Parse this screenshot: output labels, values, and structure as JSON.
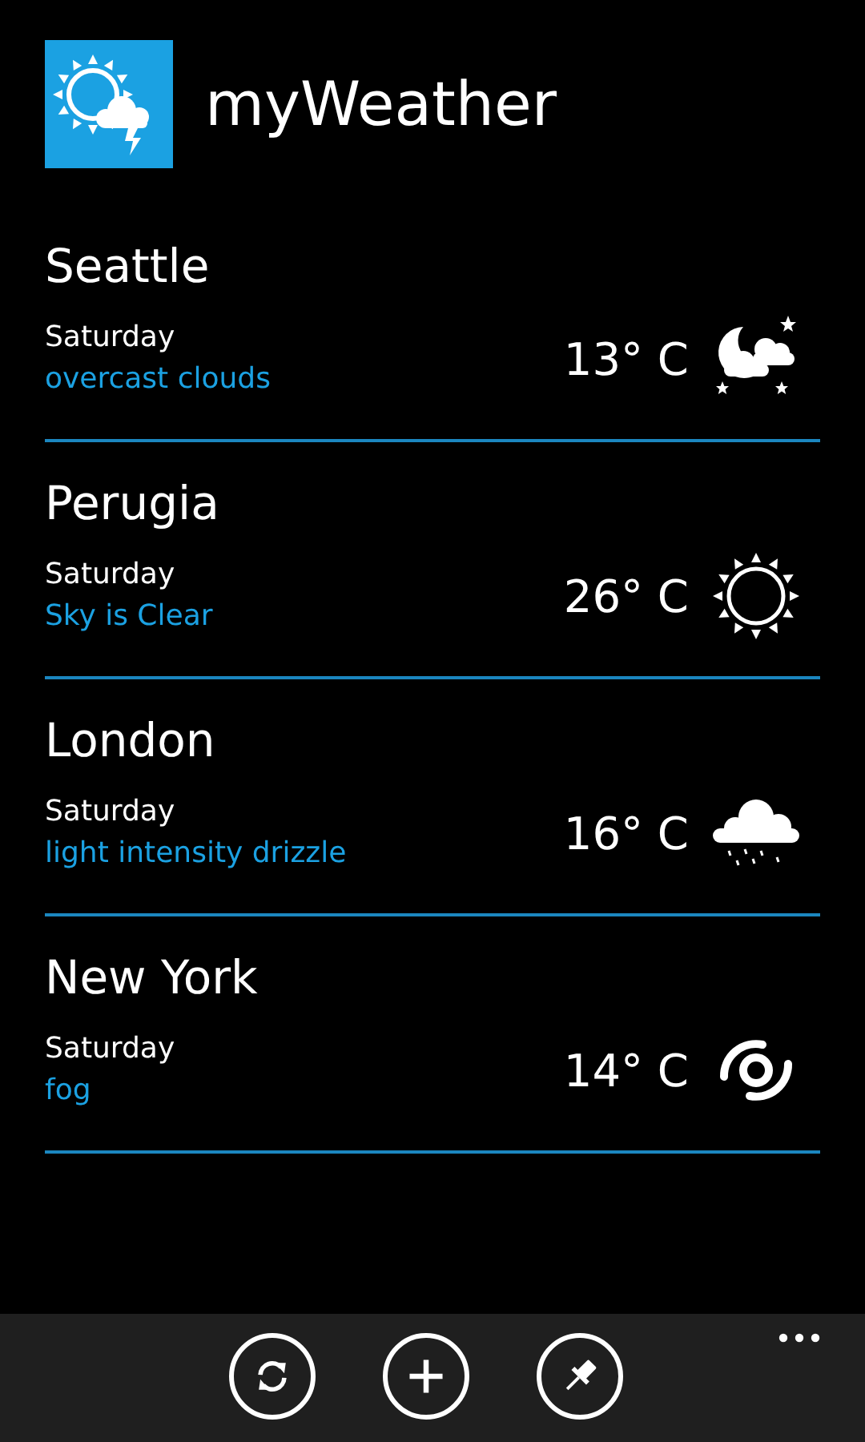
{
  "app": {
    "title": "myWeather"
  },
  "cities": [
    {
      "name": "Seattle",
      "day": "Saturday",
      "condition": "overcast clouds",
      "temperature": "13° C",
      "kind": "night-cloudy"
    },
    {
      "name": "Perugia",
      "day": "Saturday",
      "condition": "Sky is Clear",
      "temperature": "26° C",
      "kind": "sunny"
    },
    {
      "name": "London",
      "day": "Saturday",
      "condition": "light intensity drizzle",
      "temperature": "16° C",
      "kind": "rain"
    },
    {
      "name": "New York",
      "day": "Saturday",
      "condition": "fog",
      "temperature": "14° C",
      "kind": "fog"
    }
  ],
  "app_bar": {
    "buttons": [
      {
        "kind": "refresh"
      },
      {
        "kind": "add"
      },
      {
        "kind": "pin"
      }
    ]
  }
}
